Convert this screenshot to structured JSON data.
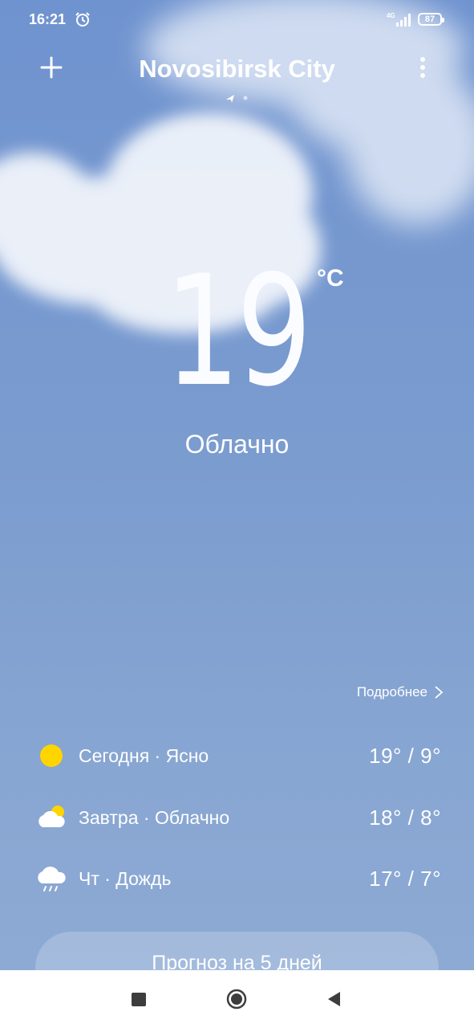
{
  "status_bar": {
    "time": "16:21",
    "network": "4G",
    "battery": "87"
  },
  "header": {
    "city": "Novosibirsk City"
  },
  "current": {
    "temperature": "19",
    "unit": "°C",
    "condition": "Облачно"
  },
  "details_link": "Подробнее",
  "forecast": [
    {
      "label": "Сегодня · Ясно",
      "temps": "19° / 9°",
      "icon": "sun-icon"
    },
    {
      "label": "Завтра · Облачно",
      "temps": "18° / 8°",
      "icon": "partly-cloudy-icon"
    },
    {
      "label": "Чт · Дождь",
      "temps": "17° / 7°",
      "icon": "rain-icon"
    }
  ],
  "five_day_button": "Прогноз на 5 дней",
  "colors": {
    "sun": "#ffd500",
    "nav_bar": "#ffffff"
  }
}
